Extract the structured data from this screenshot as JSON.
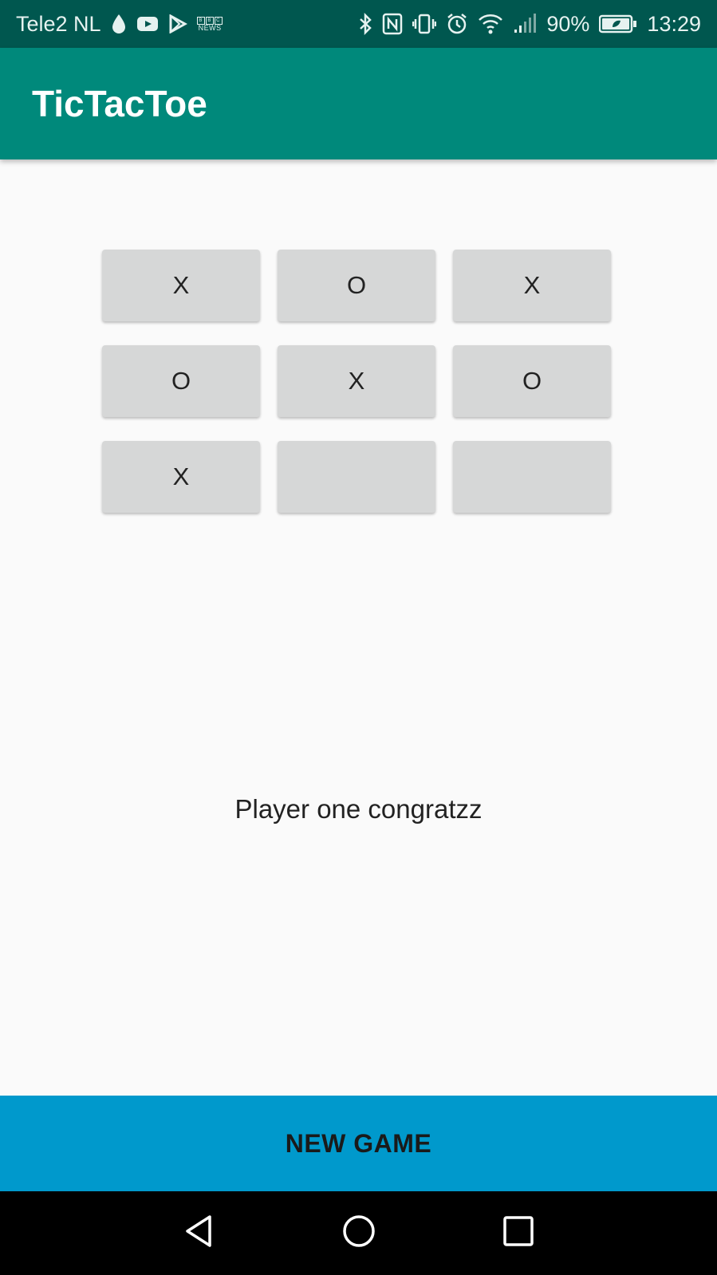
{
  "status_bar": {
    "carrier": "Tele2 NL",
    "battery": "90%",
    "time": "13:29",
    "bbc_top": "BBC",
    "bbc_bottom": "NEWS",
    "icons": [
      "drop-icon",
      "youtube-icon",
      "play-store-icon",
      "bbc-news-icon",
      "bluetooth-icon",
      "nfc-icon",
      "vibrate-icon",
      "alarm-icon",
      "wifi-icon",
      "signal-icon",
      "battery-icon"
    ]
  },
  "app_bar": {
    "title": "TicTacToe",
    "color": "#00897b"
  },
  "board": {
    "cells": [
      [
        "X",
        "O",
        "X"
      ],
      [
        "O",
        "X",
        "O"
      ],
      [
        "X",
        "",
        ""
      ]
    ]
  },
  "message": "Player one congratzz",
  "new_game_button": {
    "label": "NEW GAME",
    "color": "#0099cc"
  },
  "nav_bar": {
    "buttons": [
      "back-icon",
      "home-icon",
      "recents-icon"
    ]
  }
}
